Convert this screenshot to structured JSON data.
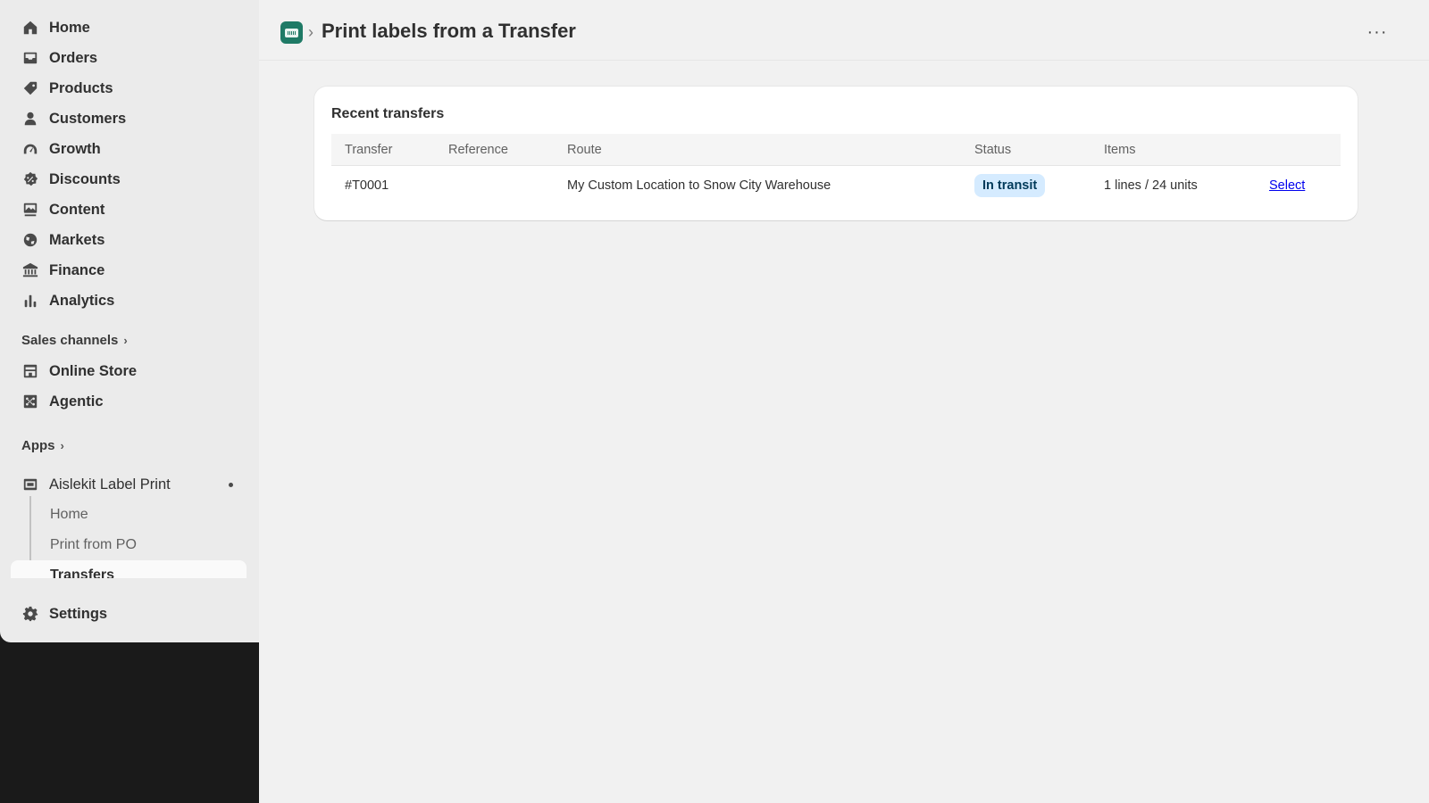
{
  "sidebar": {
    "items": [
      {
        "label": "Home",
        "icon": "home-icon"
      },
      {
        "label": "Orders",
        "icon": "inbox-icon"
      },
      {
        "label": "Products",
        "icon": "tag-icon"
      },
      {
        "label": "Customers",
        "icon": "person-icon"
      },
      {
        "label": "Growth",
        "icon": "gauge-icon"
      },
      {
        "label": "Discounts",
        "icon": "discount-icon"
      },
      {
        "label": "Content",
        "icon": "content-icon"
      },
      {
        "label": "Markets",
        "icon": "globe-icon"
      },
      {
        "label": "Finance",
        "icon": "bank-icon"
      },
      {
        "label": "Analytics",
        "icon": "bar-chart-icon"
      }
    ],
    "sales_channels": {
      "label": "Sales channels",
      "items": [
        {
          "label": "Online Store",
          "icon": "store-icon"
        },
        {
          "label": "Agentic",
          "icon": "agentic-icon"
        }
      ]
    },
    "apps": {
      "label": "Apps",
      "app": {
        "label": "Aislekit Label Print",
        "subitems": [
          "Home",
          "Print from PO",
          "Transfers"
        ]
      }
    },
    "settings_label": "Settings"
  },
  "header": {
    "title": "Print labels from a Transfer",
    "separator": "›",
    "more": "···"
  },
  "card": {
    "title": "Recent transfers",
    "columns": [
      "Transfer",
      "Reference",
      "Route",
      "Status",
      "Items"
    ],
    "rows": [
      {
        "transfer": "#T0001",
        "reference": "",
        "route": "My Custom Location to Snow City Warehouse",
        "status": "In transit",
        "items": "1 lines / 24 units",
        "action": "Select"
      }
    ]
  },
  "colors": {
    "sidebar_bg": "#ebebeb",
    "main_bg": "#f1f1f1",
    "badge_bg": "#d5ebff",
    "app_icon": "#1f7a66",
    "link": "#0000ee"
  }
}
